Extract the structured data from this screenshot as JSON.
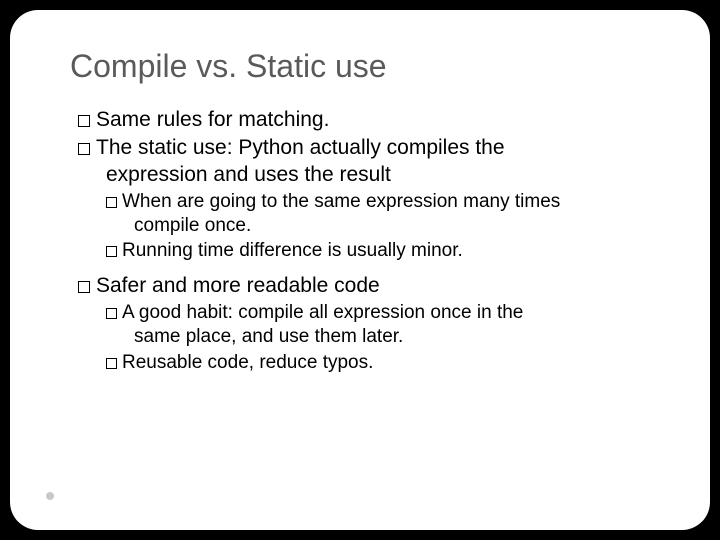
{
  "title": "Compile vs. Static use",
  "b1": "Same rules for matching.",
  "b2a": "The static use: Python actually compiles the",
  "b2b": "expression and uses the result",
  "s1a": "When are going to the same expression many times",
  "s1b": "compile once.",
  "s2": "Running time difference is usually minor.",
  "b3": "Safer and more readable code",
  "s3a": "A good habit: compile all expression once in the",
  "s3b": "same place, and use them later.",
  "s4": "Reusable code, reduce typos."
}
